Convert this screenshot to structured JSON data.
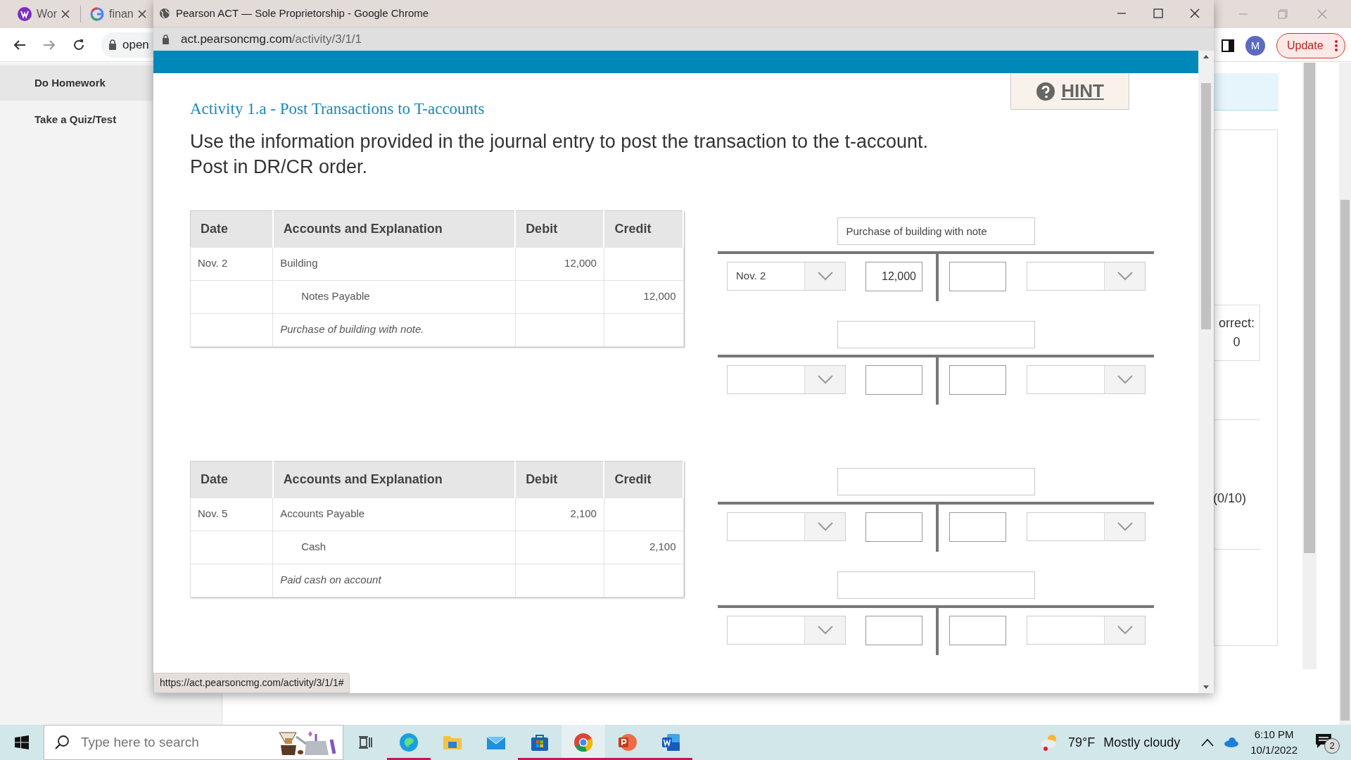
{
  "back_browser": {
    "tabs": [
      {
        "label": "Wor"
      },
      {
        "label": "finan"
      }
    ],
    "address": "open",
    "avatar": "M",
    "update_label": "Update"
  },
  "sidebar": {
    "items": [
      {
        "label": "Do Homework",
        "selected": true
      },
      {
        "label": "Take a Quiz/Test",
        "selected": false
      }
    ]
  },
  "back_page": {
    "score_label": "orrect:",
    "score_value": "0",
    "progress": "(0/10)"
  },
  "popup": {
    "title": "Pearson ACT — Sole Proprietorship - Google Chrome",
    "url_host": "act.pearsoncmg.com",
    "url_path": "/activity/3/1/1",
    "hint": "HINT",
    "activity_title": "Activity 1.a - Post Transactions to T-accounts",
    "instructions": [
      "Use the information provided in the journal entry to post the transaction to the t-account.",
      "Post in DR/CR order."
    ],
    "exercises": [
      {
        "columns": [
          "Date",
          "Accounts and Explanation",
          "Debit",
          "Credit"
        ],
        "rows": [
          {
            "kind": "debit",
            "date": "Nov. 2",
            "account": "Building",
            "debit": "12,000"
          },
          {
            "kind": "credit",
            "account": "Notes Payable",
            "credit": "12,000"
          },
          {
            "kind": "explanation",
            "account": "Purchase of building with note."
          }
        ],
        "t_accounts": [
          {
            "title": "Purchase of building with note",
            "left_date": "Nov. 2",
            "debit": "12,000"
          }
        ]
      },
      {
        "columns": [
          "Date",
          "Accounts and Explanation",
          "Debit",
          "Credit"
        ],
        "rows": [
          {
            "kind": "debit",
            "date": "Nov. 5",
            "account": "Accounts Payable",
            "debit": "2,100"
          },
          {
            "kind": "credit",
            "account": "Cash",
            "credit": "2,100"
          },
          {
            "kind": "explanation",
            "account": "Paid cash on account"
          }
        ]
      }
    ],
    "status_link": "https://act.pearsoncmg.com/activity/3/1/1#"
  },
  "taskbar": {
    "search_placeholder": "Type here to search",
    "apps": [
      {
        "kind": "edge",
        "running": true,
        "selected": false
      },
      {
        "kind": "explorer",
        "running": false,
        "selected": false
      },
      {
        "kind": "mail",
        "running": false,
        "selected": false
      },
      {
        "kind": "store",
        "running": true,
        "selected": false
      },
      {
        "kind": "chrome",
        "running": true,
        "selected": true
      },
      {
        "kind": "powerpoint",
        "running": true,
        "selected": false
      },
      {
        "kind": "word",
        "running": true,
        "selected": false
      }
    ],
    "temperature": "79°F",
    "weather": "Mostly cloudy",
    "time": "6:10 PM",
    "date": "10/1/2022",
    "notifications": "2"
  }
}
